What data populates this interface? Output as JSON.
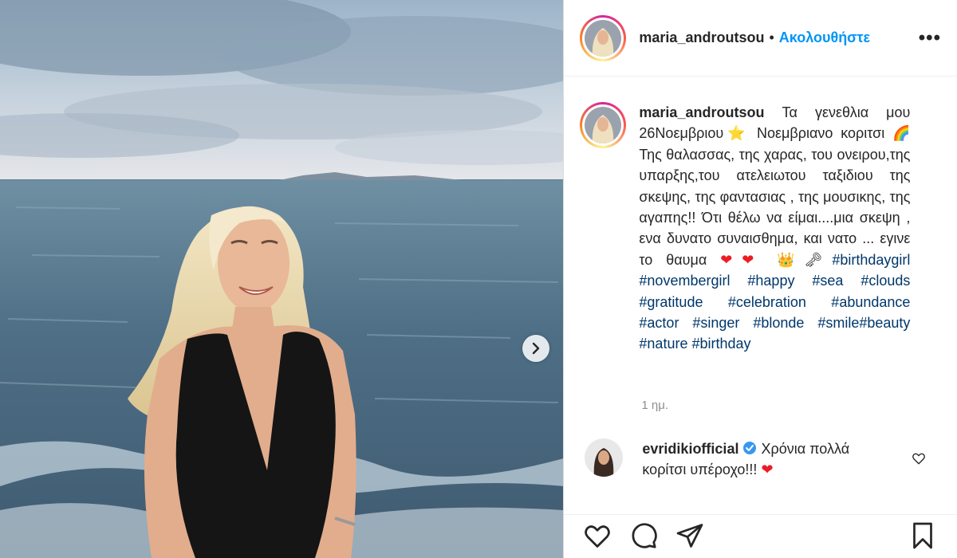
{
  "header": {
    "username": "maria_androutsou",
    "separator": "•",
    "follow_label": "Ακολουθήστε",
    "more_label": "•••"
  },
  "caption": {
    "username": "maria_androutsou",
    "text_1": "Τα γενεθλια μου 26Νοεμβριου",
    "text_2": "Νοεμβριανο κοριτσι",
    "text_3": "Της θαλασσας, της χαρας, του ονειρου,της υπαρξης,του ατελειωτου ταξιδιου της σκεψης, της φαντασιας , της μουσικης, της αγαπης!! Ότι θέλω να είμαι....μια σκεψη , ενα δυνατο συναισθημα, και νατο ... εγινε το θαυμα",
    "emoji_star": "⭐",
    "emoji_rainbow": "🌈",
    "emoji_hearts": "❤❤",
    "emoji_crown": "👑",
    "emoji_key": "🗝",
    "hashtags": "#birthdaygirl #novembergirl #happy #sea #clouds #gratitude #celebration #abundance #actor #singer #blonde #smile#beauty #nature #birthday"
  },
  "time_label": "1 ημ.",
  "comment": {
    "username": "evridikiofficial",
    "text": "Χρόνια πολλά κορίτσι υπέροχο!!!",
    "emoji_heart": "❤"
  },
  "icons": {
    "more": "more-options-icon",
    "carousel": "chevron-right-icon",
    "verified": "verified-badge-icon",
    "comment_like": "heart-outline-icon",
    "like": "heart-outline-icon",
    "comment": "speech-bubble-icon",
    "share": "paper-plane-icon",
    "save": "bookmark-icon"
  },
  "colors": {
    "link_blue": "#0095f6",
    "hashtag_blue": "#00376b",
    "heart_red": "#ed1c24",
    "muted": "#8e8e8e"
  }
}
